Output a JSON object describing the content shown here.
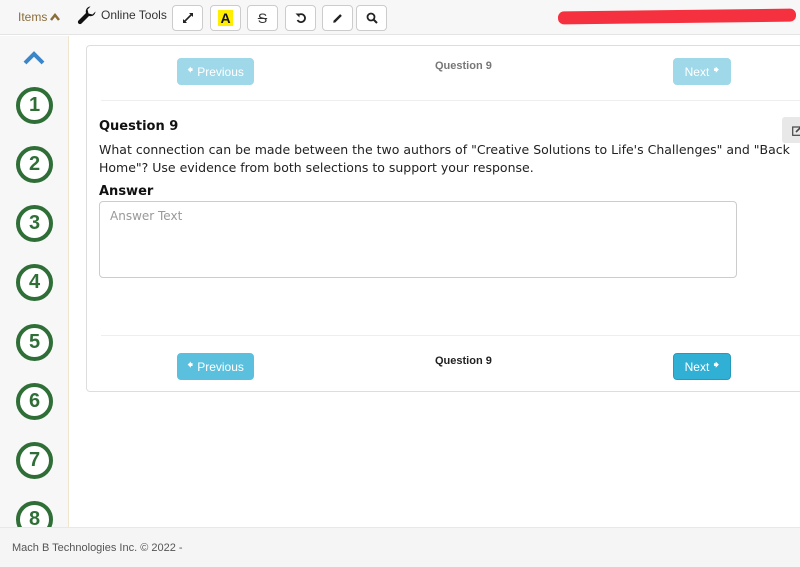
{
  "toolbar": {
    "items_label": "Items",
    "online_tools_label": "Online Tools",
    "tools": [
      {
        "name": "expand-tool",
        "icon": "expand-arrows-icon"
      },
      {
        "name": "highlight-tool",
        "icon": "highlighter-A-icon",
        "glyph": "A"
      },
      {
        "name": "strikethrough-tool",
        "icon": "strikethrough-icon",
        "glyph": "S"
      },
      {
        "name": "undo-tool",
        "icon": "undo-icon"
      },
      {
        "name": "pencil-tool",
        "icon": "pencil-icon"
      },
      {
        "name": "search-tool",
        "icon": "search-icon"
      }
    ]
  },
  "sidebar": {
    "questions": [
      "1",
      "2",
      "3",
      "4",
      "5",
      "6",
      "7",
      "8"
    ],
    "accent": "#2f6f37"
  },
  "navigation": {
    "previous_label": "Previous",
    "next_label": "Next",
    "question_indicator": "Question 9"
  },
  "question": {
    "title": "Question 9",
    "text": "What connection can be made between the two authors of \"Creative Solutions to Life's Challenges\" and \"Back Home\"? Use evidence from both selections to support your response.",
    "answer_label": "Answer",
    "answer_placeholder": "Answer Text",
    "answer_value": ""
  },
  "footer": {
    "copyright": "Mach B Technologies Inc. © 2022 -"
  },
  "colors": {
    "button_disabled": "#9fd8e8",
    "button_info": "#5bc0de",
    "button_info_dark": "#31b0d5",
    "items_link": "#8a6d3b"
  }
}
